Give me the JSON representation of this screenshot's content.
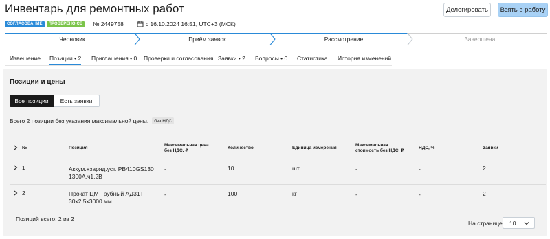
{
  "header": {
    "title": "Инвентарь для ремонтных работ",
    "delegate_label": "Делегировать",
    "take_label": "Взять в работу"
  },
  "meta": {
    "badge_status": "СОГЛАСОВАНИЕ",
    "badge_checked": "ПРОВЕРЕНО СБ",
    "number": "№ 2449758",
    "date": "с 16.10.2024 16:51, UTC+3 (МСК)",
    "calendar_icon": "calendar-icon"
  },
  "stepper": {
    "steps": [
      {
        "label": "Черновик",
        "state": "done"
      },
      {
        "label": "Приём заявок",
        "state": "done"
      },
      {
        "label": "Рассмотрение",
        "state": "current"
      },
      {
        "label": "Завершена",
        "state": "pending"
      }
    ],
    "colors": {
      "done": "#2a8ad8",
      "pending": "#d0d0d0",
      "pending_text": "#9a9a9a"
    }
  },
  "tabs": [
    {
      "label": "Извещение",
      "active": false
    },
    {
      "label": "Позиции • 2",
      "active": true
    },
    {
      "label": "Приглашения • 0",
      "active": false
    },
    {
      "label": "Проверки и согласования",
      "active": false
    },
    {
      "label": "Заявки • 2",
      "active": false
    },
    {
      "label": "Вопросы • 0",
      "active": false
    },
    {
      "label": "Статистика",
      "active": false
    },
    {
      "label": "История изменений",
      "active": false
    }
  ],
  "positions": {
    "title": "Позиции и цены",
    "filters": {
      "all": "Все позиции",
      "has_bids": "Есть заявки"
    },
    "summary": "Всего 2 позиции без указания максимальной цены.",
    "vat_chip": "без НДС",
    "columns": {
      "num": "№",
      "position": "Позиция",
      "max_price_l1": "Максимальная цена",
      "max_price_l2": "без НДС, ₽",
      "quantity": "Количество",
      "unit": "Единица измерения",
      "max_cost_l1": "Максимальная",
      "max_cost_l2": "стоимость без НДС, ₽",
      "vat": "НДС, %",
      "bids": "Заявки"
    },
    "rows": [
      {
        "num": "1",
        "name_l1": "Аккум.+заряд.уст. PB410GS130",
        "name_l2": "1300А.ч1,2В",
        "max_price": "-",
        "quantity": "10",
        "unit": "шт",
        "max_cost": "-",
        "vat": "-",
        "bids": "2"
      },
      {
        "num": "2",
        "name_l1": "Прокат ЦМ Трубный АД31Т",
        "name_l2": "30х2,5х3000 мм",
        "max_price": "-",
        "quantity": "100",
        "unit": "кг",
        "max_cost": "-",
        "vat": "-",
        "bids": "2"
      }
    ],
    "total_text": "Позиций всего: 2 из 2",
    "per_page_label": "На странице",
    "per_page_value": "10"
  }
}
